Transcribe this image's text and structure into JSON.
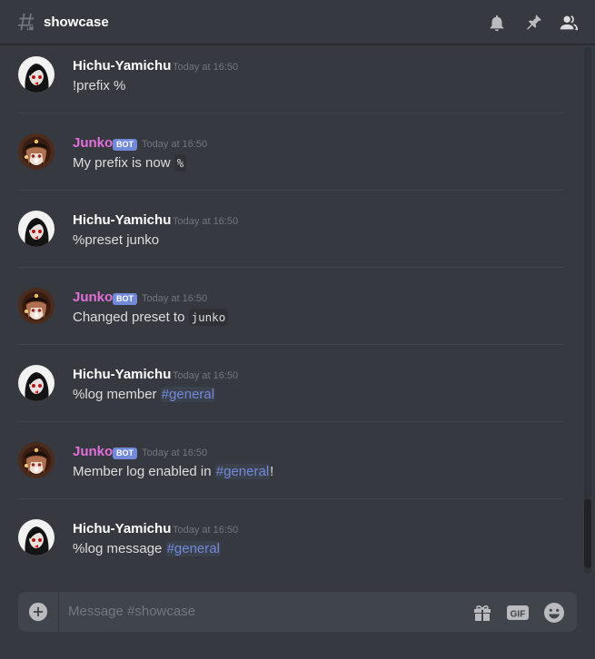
{
  "header": {
    "channel_name": "showcase",
    "icons": [
      "hashtag-icon",
      "bell-icon",
      "pin-icon",
      "members-icon"
    ]
  },
  "messages": [
    {
      "author": "Hichu-Yamichu",
      "bot": false,
      "timestamp": "Today at 16:50",
      "content": [
        {
          "type": "text",
          "value": "!prefix %"
        }
      ]
    },
    {
      "author": "Junko",
      "bot": true,
      "bot_label": "BOT",
      "timestamp": "Today at 16:50",
      "content": [
        {
          "type": "text",
          "value": "My prefix is now "
        },
        {
          "type": "code",
          "value": "%"
        }
      ]
    },
    {
      "author": "Hichu-Yamichu",
      "bot": false,
      "timestamp": "Today at 16:50",
      "content": [
        {
          "type": "text",
          "value": "%preset junko"
        }
      ]
    },
    {
      "author": "Junko",
      "bot": true,
      "bot_label": "BOT",
      "timestamp": "Today at 16:50",
      "content": [
        {
          "type": "text",
          "value": "Changed preset to "
        },
        {
          "type": "code",
          "value": "junko"
        }
      ]
    },
    {
      "author": "Hichu-Yamichu",
      "bot": false,
      "timestamp": "Today at 16:50",
      "content": [
        {
          "type": "text",
          "value": "%log member "
        },
        {
          "type": "mention",
          "value": "#general"
        }
      ]
    },
    {
      "author": "Junko",
      "bot": true,
      "bot_label": "BOT",
      "timestamp": "Today at 16:50",
      "content": [
        {
          "type": "text",
          "value": "Member log enabled in "
        },
        {
          "type": "mention",
          "value": "#general"
        },
        {
          "type": "text",
          "value": "!"
        }
      ]
    },
    {
      "author": "Hichu-Yamichu",
      "bot": false,
      "timestamp": "Today at 16:50",
      "content": [
        {
          "type": "text",
          "value": "%log message "
        },
        {
          "type": "mention",
          "value": "#general"
        }
      ]
    }
  ],
  "composer": {
    "placeholder": "Message #showcase",
    "gif_label": "GIF",
    "icons": [
      "plus-circle-icon",
      "gift-icon",
      "gif-icon",
      "emoji-icon"
    ]
  },
  "colors": {
    "background": "#36393f",
    "bot_name": "#e36fdb",
    "bot_badge": "#7289da",
    "mention": "#7289da",
    "timestamp": "#72767d",
    "composer_bg": "#40444b"
  }
}
